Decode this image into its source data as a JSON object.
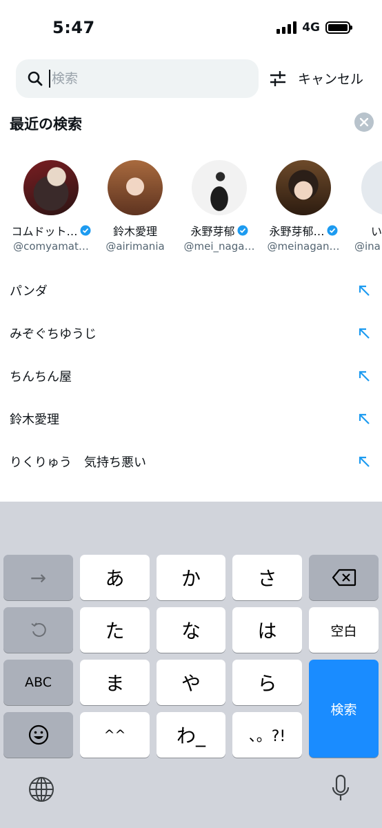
{
  "status_bar": {
    "time": "5:47",
    "network": "4G"
  },
  "search": {
    "placeholder": "検索",
    "value": "",
    "cancel_label": "キャンセル"
  },
  "recent": {
    "title": "最近の検索",
    "profiles": [
      {
        "name": "コムドット…",
        "handle": "@comyamat…",
        "verified": true
      },
      {
        "name": "鈴木愛理",
        "handle": "@airimania",
        "verified": false
      },
      {
        "name": "永野芽郁",
        "handle": "@mei_naga…",
        "verified": true
      },
      {
        "name": "永野芽郁…",
        "handle": "@meinagan…",
        "verified": true
      },
      {
        "name": "い",
        "handle": "@ina",
        "verified": false
      }
    ],
    "queries": [
      "パンダ",
      "みぞぐちゆうじ",
      "ちんちん屋",
      "鈴木愛理",
      "りくりゅう　気持ち悪い"
    ]
  },
  "keyboard": {
    "row1": [
      "→",
      "あ",
      "か",
      "さ",
      "⌫"
    ],
    "row2": [
      "↺",
      "た",
      "な",
      "は",
      "空白"
    ],
    "row3": [
      "ABC",
      "ま",
      "や",
      "ら"
    ],
    "row4": [
      "☺",
      "^^",
      "わ_",
      "、。?!"
    ],
    "search_key": "検索"
  },
  "colors": {
    "verified": "#1d9bf0",
    "accent_blue": "#1a8cff",
    "arrow": "#1d9bf0"
  }
}
